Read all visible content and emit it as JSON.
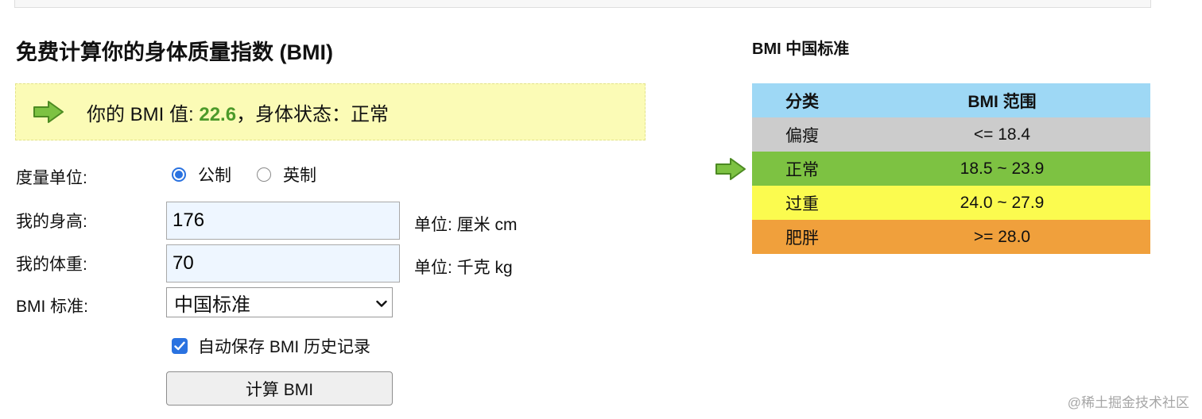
{
  "header": {
    "title": "免费计算你的身体质量指数 (BMI)"
  },
  "result": {
    "prefix": "你的 BMI 值: ",
    "bmi_value": "22.6",
    "suffix": "，身体状态：正常",
    "arrow_icon": "arrow-right-icon",
    "value_color": "#4c9a2a",
    "background_color": "#fbfbb6"
  },
  "form": {
    "unit_label": "度量单位:",
    "unit_options": [
      {
        "label": "公制",
        "checked": true
      },
      {
        "label": "英制",
        "checked": false
      }
    ],
    "height_label": "我的身高:",
    "height_value": "176",
    "height_unit": "单位: 厘米 cm",
    "weight_label": "我的体重:",
    "weight_value": "70",
    "weight_unit": "单位: 千克 kg",
    "standard_label": "BMI 标准:",
    "standard_value": "中国标准",
    "autosave_label": "自动保存 BMI 历史记录",
    "autosave_checked": true,
    "calculate_label": "计算 BMI",
    "accent_color": "#2a72e0"
  },
  "standard": {
    "title": "BMI 中国标准",
    "headers": [
      "分类",
      "BMI 范围"
    ],
    "rows": [
      {
        "category": "偏瘦",
        "range": "<= 18.4",
        "color": "#cccccc"
      },
      {
        "category": "正常",
        "range": "18.5 ~ 23.9",
        "color": "#7dc242",
        "current": true
      },
      {
        "category": "过重",
        "range": "24.0 ~ 27.9",
        "color": "#fbfb4f"
      },
      {
        "category": "肥胖",
        "range": ">= 28.0",
        "color": "#f0a03c"
      }
    ],
    "header_color": "#9ed8f5"
  },
  "watermark": "@稀土掘金技术社区"
}
